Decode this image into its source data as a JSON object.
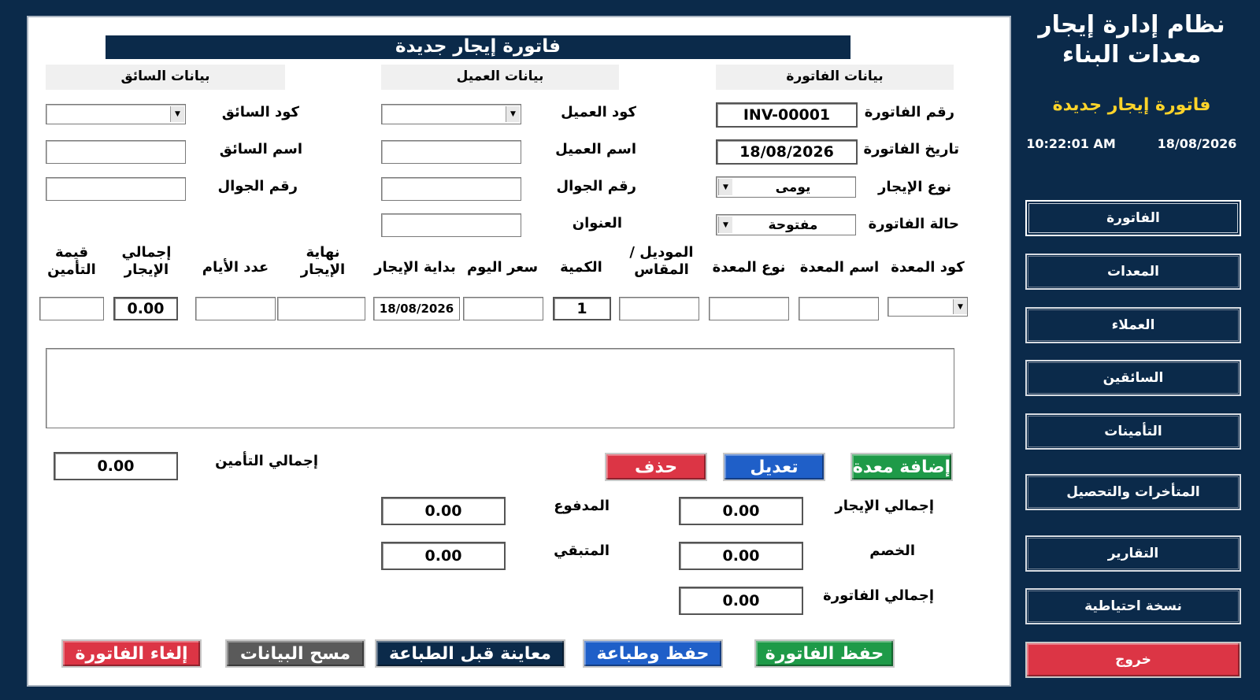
{
  "app": {
    "title_line1": "نظام إدارة إيجار",
    "title_line2": "معدات البناء",
    "current_form": "فاتورة إيجار جديدة",
    "time": "10:22:01 AM",
    "date": "18/08/2026"
  },
  "nav": [
    {
      "label": "الفاتورة"
    },
    {
      "label": "المعدات"
    },
    {
      "label": "العملاء"
    },
    {
      "label": "السائقين"
    },
    {
      "label": "التأمينات"
    },
    {
      "label": "المتأخرات والتحصيل"
    },
    {
      "label": "التقارير"
    },
    {
      "label": "نسخة احتياطية"
    },
    {
      "label": "خروج"
    }
  ],
  "form": {
    "title": "فاتورة إيجار جديدة",
    "sections": {
      "invoice": "بيانات الفاتورة",
      "customer": "بيانات العميل",
      "driver": "بيانات السائق"
    },
    "invoice": {
      "number_label": "رقم الفاتورة",
      "number_value": "INV-00001",
      "date_label": "تاريخ الفاتورة",
      "date_value": "18/08/2026",
      "rent_type_label": "نوع الإيجار",
      "rent_type_value": "يومى",
      "status_label": "حالة الفاتورة",
      "status_value": "مفتوحة"
    },
    "customer": {
      "code_label": "كود العميل",
      "name_label": "اسم العميل",
      "mobile_label": "رقم الجوال",
      "address_label": "العنوان"
    },
    "driver": {
      "code_label": "كود السائق",
      "name_label": "اسم السائق",
      "mobile_label": "رقم الجوال"
    },
    "equipment_columns": {
      "code": "كود المعدة",
      "name": "اسم المعدة",
      "type": "نوع المعدة",
      "model": "الموديل / المقاس",
      "quantity": "الكمية",
      "day_price": "سعر اليوم",
      "start": "بداية الإيجار",
      "end": "نهاية الإيجار",
      "days": "عدد الأيام",
      "rent_total": "إجمالي الإيجار",
      "insurance_value": "قيمة التأمين"
    },
    "equipment_entry": {
      "quantity": "1",
      "start": "18/08/2026",
      "rent_total": "0.00"
    },
    "buttons": {
      "add_equipment": "إضافة معدة",
      "edit": "تعديل",
      "delete": "حذف",
      "save_invoice": "حفظ الفاتورة",
      "save_print": "حفظ وطباعة",
      "preview": "معاينة قبل الطباعة",
      "clear": "مسح البيانات",
      "cancel_invoice": "إلغاء الفاتورة"
    },
    "totals": {
      "insurance_label": "إجمالي التأمين",
      "insurance_value": "0.00",
      "rent_label": "إجمالي الإيجار",
      "rent_value": "0.00",
      "discount_label": "الخصم",
      "discount_value": "0.00",
      "invoice_label": "إجمالي الفاتورة",
      "invoice_value": "0.00",
      "paid_label": "المدفوع",
      "paid_value": "0.00",
      "remaining_label": "المتبقي",
      "remaining_value": "0.00"
    }
  },
  "colors": {
    "navy": "#0b2a4a",
    "accent_yellow": "#ffd42a",
    "green": "#1e9a48",
    "blue": "#1f5fc8",
    "red": "#dc3545",
    "gray": "#5a5a5a"
  }
}
